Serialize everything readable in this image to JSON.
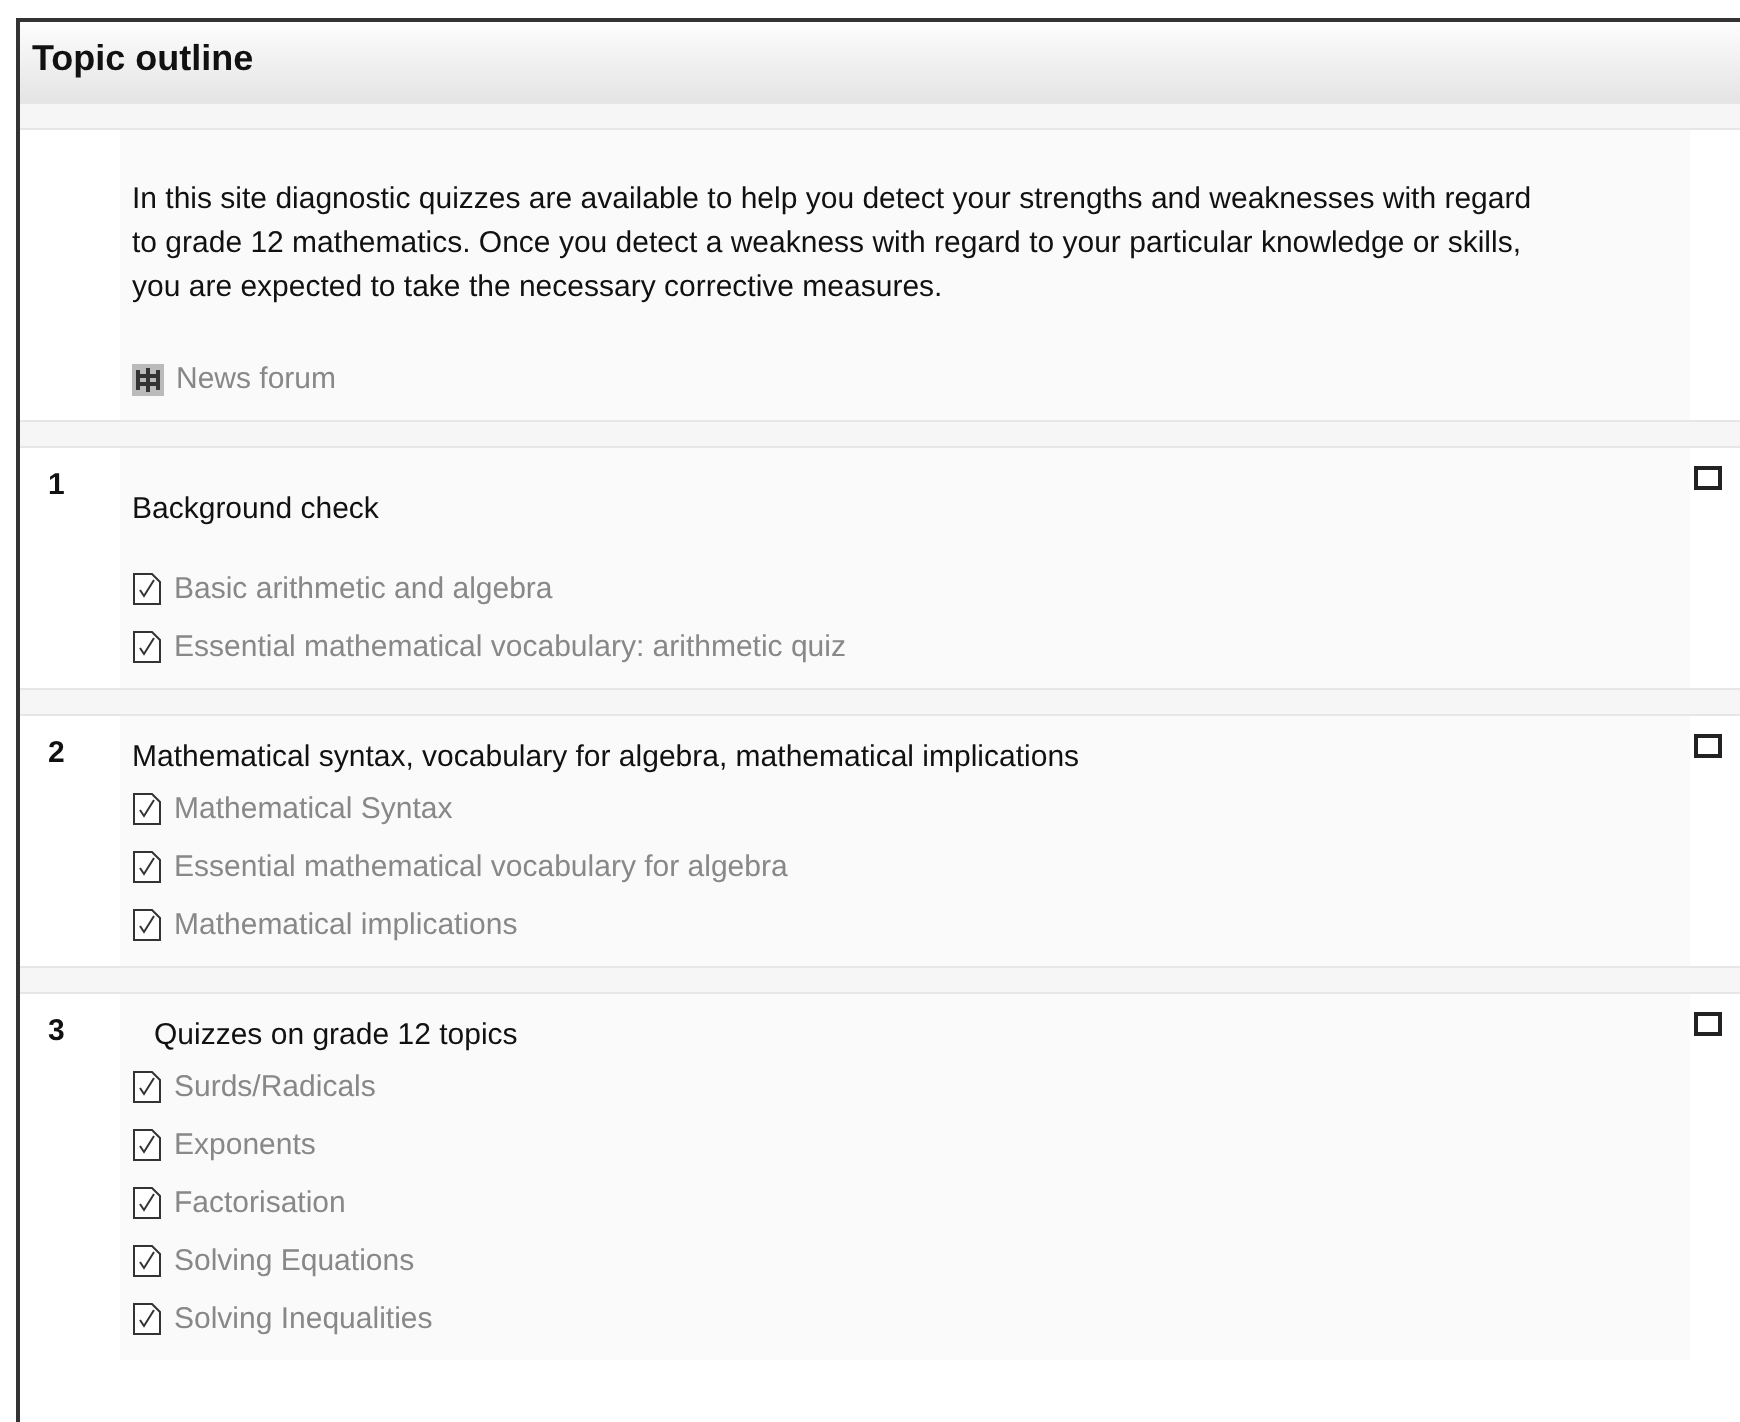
{
  "title": "Topic outline",
  "intro": {
    "summary": "In this site diagnostic quizzes are available to help you detect your strengths and weaknesses with regard to grade 12 mathematics. Once you detect a weakness with regard to your particular knowledge or skills, you are expected to take the necessary corrective measures.",
    "activities": [
      {
        "kind": "forum",
        "name": "News forum"
      }
    ]
  },
  "sections": [
    {
      "number": "1",
      "title": "Background check",
      "checked": false,
      "activities": [
        {
          "kind": "quiz",
          "name": "Basic arithmetic and algebra"
        },
        {
          "kind": "quiz",
          "name": "Essential mathematical vocabulary: arithmetic quiz"
        }
      ]
    },
    {
      "number": "2",
      "title": "Mathematical syntax, vocabulary for algebra, mathematical implications",
      "checked": false,
      "activities": [
        {
          "kind": "quiz",
          "name": "Mathematical Syntax"
        },
        {
          "kind": "quiz",
          "name": "Essential mathematical vocabulary for algebra"
        },
        {
          "kind": "quiz",
          "name": "Mathematical implications"
        }
      ]
    },
    {
      "number": "3",
      "title": "Quizzes on grade 12 topics",
      "checked": false,
      "activities": [
        {
          "kind": "quiz",
          "name": "Surds/Radicals"
        },
        {
          "kind": "quiz",
          "name": "Exponents"
        },
        {
          "kind": "quiz",
          "name": "Factorisation"
        },
        {
          "kind": "quiz",
          "name": "Solving Equations"
        },
        {
          "kind": "quiz",
          "name": "Solving Inequalities"
        }
      ]
    }
  ]
}
